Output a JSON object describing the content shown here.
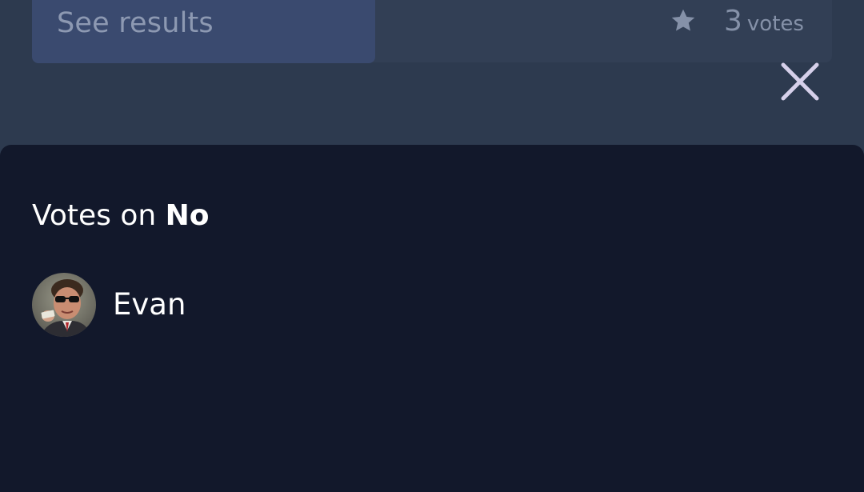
{
  "poll": {
    "see_results_label": "See results",
    "vote_count": "3",
    "vote_unit": "votes"
  },
  "sheet": {
    "title_prefix": "Votes on ",
    "option_name": "No",
    "voters": [
      {
        "name": "Evan"
      }
    ]
  },
  "icons": {
    "star": "star-icon",
    "close": "close-icon",
    "avatar": "avatar"
  },
  "colors": {
    "background_top": "#2d3a4f",
    "see_results_bg": "#3a4a6f",
    "sheet_bg": "#12182b",
    "close_icon": "#d6d0ea",
    "muted_text": "#8591a8"
  }
}
